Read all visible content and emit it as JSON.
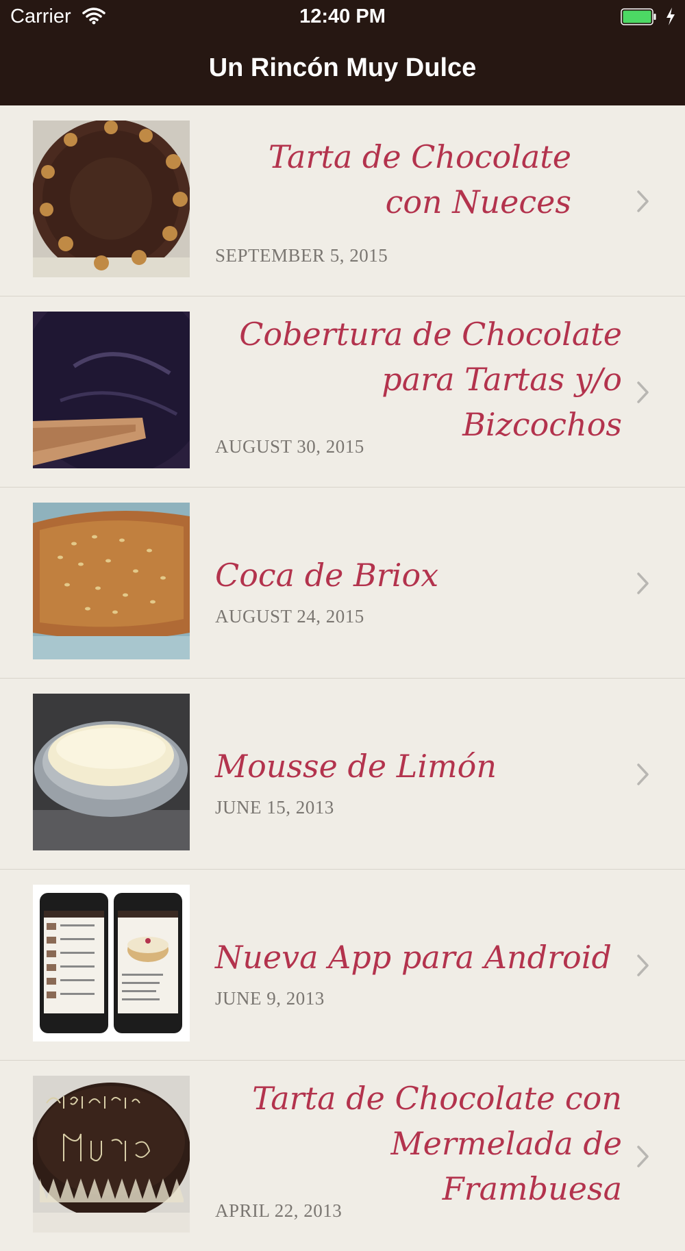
{
  "status_bar": {
    "carrier": "Carrier",
    "time": "12:40 PM"
  },
  "nav": {
    "title": "Un Rincón Muy Dulce"
  },
  "posts": [
    {
      "title": "Tarta de Chocolate con Nueces",
      "date": "SEPTEMBER 5, 2015"
    },
    {
      "title": "Cobertura de Chocolate para Tartas y/o Bizcochos",
      "date": "AUGUST 30, 2015"
    },
    {
      "title": "Coca de Briox",
      "date": "AUGUST 24, 2015"
    },
    {
      "title": "Mousse de Limón",
      "date": "JUNE 15, 2013"
    },
    {
      "title": "Nueva App para Android",
      "date": "JUNE 9, 2013"
    },
    {
      "title": "Tarta de Chocolate con Mermelada de Frambuesa",
      "date": "APRIL 22, 2013"
    }
  ],
  "colors": {
    "nav_background": "#261712",
    "title_color": "#b3334d",
    "list_background": "#f0ede6",
    "battery_fill": "#4cd964"
  },
  "icons": {
    "row_accessory": "chevron-right-icon",
    "wifi": "wifi-icon",
    "battery": "battery-icon",
    "charging": "charging-bolt-icon"
  }
}
